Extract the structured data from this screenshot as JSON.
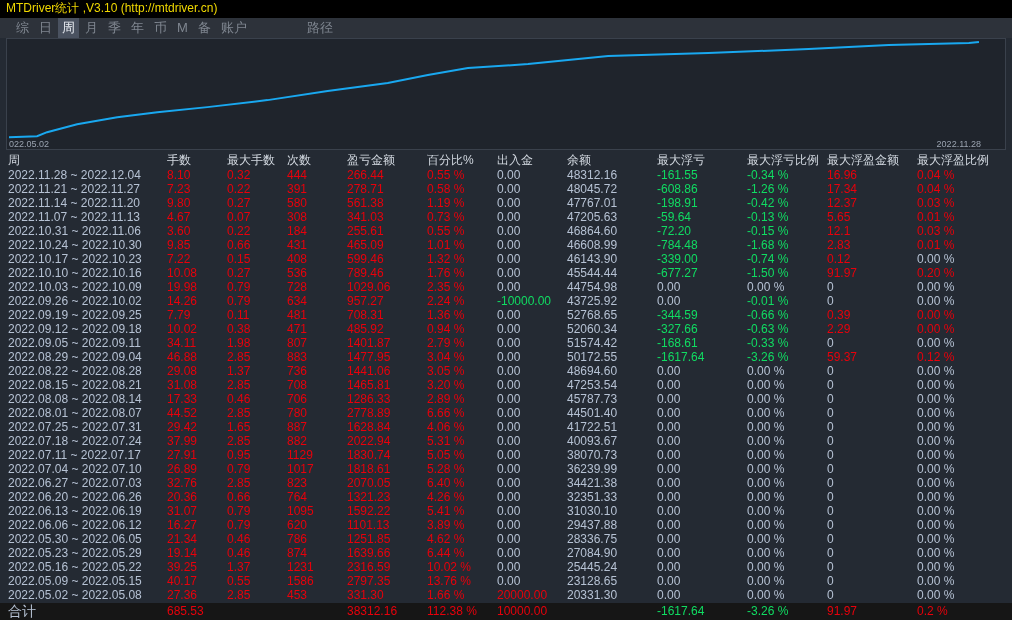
{
  "window": {
    "title": "MTDriver统计 ,V3.10 (http://mtdriver.cn)"
  },
  "tabs": [
    {
      "label": "综",
      "selected": false
    },
    {
      "label": "日",
      "selected": false
    },
    {
      "label": "周",
      "selected": true
    },
    {
      "label": "月",
      "selected": false
    },
    {
      "label": "季",
      "selected": false
    },
    {
      "label": "年",
      "selected": false
    },
    {
      "label": "币",
      "selected": false
    },
    {
      "label": "M",
      "selected": false
    },
    {
      "label": "备",
      "selected": false
    },
    {
      "label": "账户",
      "selected": false
    }
  ],
  "path_tab": {
    "label": "路径",
    "selected": false
  },
  "equity_chart": {
    "start_label": "022.05.02",
    "end_label": "2022.11.28"
  },
  "table": {
    "columns": [
      "周",
      "手数",
      "最大手数",
      "次数",
      "盈亏金额",
      "百分比%",
      "出入金",
      "余额",
      "最大浮亏",
      "最大浮亏比例",
      "最大浮盈金额",
      "最大浮盈比例"
    ],
    "rows": [
      {
        "cells": [
          {
            "text": "2022.11.28 ~ 2022.12.04",
            "color": "#b6c2d4"
          },
          {
            "text": "8.10",
            "color": "#e8000b"
          },
          {
            "text": "0.32",
            "color": "#e8000b"
          },
          {
            "text": "444",
            "color": "#e8000b"
          },
          {
            "text": "266.44",
            "color": "#e8000b"
          },
          {
            "text": "0.55 %",
            "color": "#e8000b"
          },
          {
            "text": "0.00",
            "color": "#b6c2d4"
          },
          {
            "text": "48312.16",
            "color": "#b6c2d4"
          },
          {
            "text": "-161.55",
            "color": "#10dc62"
          },
          {
            "text": "-0.34 %",
            "color": "#10dc62"
          },
          {
            "text": "16.96",
            "color": "#e8000b"
          },
          {
            "text": "0.04 %",
            "color": "#e8000b"
          }
        ]
      },
      {
        "cells": [
          {
            "text": "2022.11.21 ~ 2022.11.27",
            "color": "#b6c2d4"
          },
          {
            "text": "7.23",
            "color": "#e8000b"
          },
          {
            "text": "0.22",
            "color": "#e8000b"
          },
          {
            "text": "391",
            "color": "#e8000b"
          },
          {
            "text": "278.71",
            "color": "#e8000b"
          },
          {
            "text": "0.58 %",
            "color": "#e8000b"
          },
          {
            "text": "0.00",
            "color": "#b6c2d4"
          },
          {
            "text": "48045.72",
            "color": "#b6c2d4"
          },
          {
            "text": "-608.86",
            "color": "#10dc62"
          },
          {
            "text": "-1.26 %",
            "color": "#10dc62"
          },
          {
            "text": "17.34",
            "color": "#e8000b"
          },
          {
            "text": "0.04 %",
            "color": "#e8000b"
          }
        ]
      },
      {
        "cells": [
          {
            "text": "2022.11.14 ~ 2022.11.20",
            "color": "#b6c2d4"
          },
          {
            "text": "9.80",
            "color": "#e8000b"
          },
          {
            "text": "0.27",
            "color": "#e8000b"
          },
          {
            "text": "580",
            "color": "#e8000b"
          },
          {
            "text": "561.38",
            "color": "#e8000b"
          },
          {
            "text": "1.19 %",
            "color": "#e8000b"
          },
          {
            "text": "0.00",
            "color": "#b6c2d4"
          },
          {
            "text": "47767.01",
            "color": "#b6c2d4"
          },
          {
            "text": "-198.91",
            "color": "#10dc62"
          },
          {
            "text": "-0.42 %",
            "color": "#10dc62"
          },
          {
            "text": "12.37",
            "color": "#e8000b"
          },
          {
            "text": "0.03 %",
            "color": "#e8000b"
          }
        ]
      },
      {
        "cells": [
          {
            "text": "2022.11.07 ~ 2022.11.13",
            "color": "#b6c2d4"
          },
          {
            "text": "4.67",
            "color": "#e8000b"
          },
          {
            "text": "0.07",
            "color": "#e8000b"
          },
          {
            "text": "308",
            "color": "#e8000b"
          },
          {
            "text": "341.03",
            "color": "#e8000b"
          },
          {
            "text": "0.73 %",
            "color": "#e8000b"
          },
          {
            "text": "0.00",
            "color": "#b6c2d4"
          },
          {
            "text": "47205.63",
            "color": "#b6c2d4"
          },
          {
            "text": "-59.64",
            "color": "#10dc62"
          },
          {
            "text": "-0.13 %",
            "color": "#10dc62"
          },
          {
            "text": "5.65",
            "color": "#e8000b"
          },
          {
            "text": "0.01 %",
            "color": "#e8000b"
          }
        ]
      },
      {
        "cells": [
          {
            "text": "2022.10.31 ~ 2022.11.06",
            "color": "#b6c2d4"
          },
          {
            "text": "3.60",
            "color": "#e8000b"
          },
          {
            "text": "0.22",
            "color": "#e8000b"
          },
          {
            "text": "184",
            "color": "#e8000b"
          },
          {
            "text": "255.61",
            "color": "#e8000b"
          },
          {
            "text": "0.55 %",
            "color": "#e8000b"
          },
          {
            "text": "0.00",
            "color": "#b6c2d4"
          },
          {
            "text": "46864.60",
            "color": "#b6c2d4"
          },
          {
            "text": "-72.20",
            "color": "#10dc62"
          },
          {
            "text": "-0.15 %",
            "color": "#10dc62"
          },
          {
            "text": "12.1",
            "color": "#e8000b"
          },
          {
            "text": "0.03 %",
            "color": "#e8000b"
          }
        ]
      },
      {
        "cells": [
          {
            "text": "2022.10.24 ~ 2022.10.30",
            "color": "#b6c2d4"
          },
          {
            "text": "9.85",
            "color": "#e8000b"
          },
          {
            "text": "0.66",
            "color": "#e8000b"
          },
          {
            "text": "431",
            "color": "#e8000b"
          },
          {
            "text": "465.09",
            "color": "#e8000b"
          },
          {
            "text": "1.01 %",
            "color": "#e8000b"
          },
          {
            "text": "0.00",
            "color": "#b6c2d4"
          },
          {
            "text": "46608.99",
            "color": "#b6c2d4"
          },
          {
            "text": "-784.48",
            "color": "#10dc62"
          },
          {
            "text": "-1.68 %",
            "color": "#10dc62"
          },
          {
            "text": "2.83",
            "color": "#e8000b"
          },
          {
            "text": "0.01 %",
            "color": "#e8000b"
          }
        ]
      },
      {
        "cells": [
          {
            "text": "2022.10.17 ~ 2022.10.23",
            "color": "#b6c2d4"
          },
          {
            "text": "7.22",
            "color": "#e8000b"
          },
          {
            "text": "0.15",
            "color": "#e8000b"
          },
          {
            "text": "408",
            "color": "#e8000b"
          },
          {
            "text": "599.46",
            "color": "#e8000b"
          },
          {
            "text": "1.32 %",
            "color": "#e8000b"
          },
          {
            "text": "0.00",
            "color": "#b6c2d4"
          },
          {
            "text": "46143.90",
            "color": "#b6c2d4"
          },
          {
            "text": "-339.00",
            "color": "#10dc62"
          },
          {
            "text": "-0.74 %",
            "color": "#10dc62"
          },
          {
            "text": "0.12",
            "color": "#e8000b"
          },
          {
            "text": "0.00 %",
            "color": "#b6c2d4"
          }
        ]
      },
      {
        "cells": [
          {
            "text": "2022.10.10 ~ 2022.10.16",
            "color": "#b6c2d4"
          },
          {
            "text": "10.08",
            "color": "#e8000b"
          },
          {
            "text": "0.27",
            "color": "#e8000b"
          },
          {
            "text": "536",
            "color": "#e8000b"
          },
          {
            "text": "789.46",
            "color": "#e8000b"
          },
          {
            "text": "1.76 %",
            "color": "#e8000b"
          },
          {
            "text": "0.00",
            "color": "#b6c2d4"
          },
          {
            "text": "45544.44",
            "color": "#b6c2d4"
          },
          {
            "text": "-677.27",
            "color": "#10dc62"
          },
          {
            "text": "-1.50 %",
            "color": "#10dc62"
          },
          {
            "text": "91.97",
            "color": "#e8000b"
          },
          {
            "text": "0.20 %",
            "color": "#e8000b"
          }
        ]
      },
      {
        "cells": [
          {
            "text": "2022.10.03 ~ 2022.10.09",
            "color": "#b6c2d4"
          },
          {
            "text": "19.98",
            "color": "#e8000b"
          },
          {
            "text": "0.79",
            "color": "#e8000b"
          },
          {
            "text": "728",
            "color": "#e8000b"
          },
          {
            "text": "1029.06",
            "color": "#e8000b"
          },
          {
            "text": "2.35 %",
            "color": "#e8000b"
          },
          {
            "text": "0.00",
            "color": "#b6c2d4"
          },
          {
            "text": "44754.98",
            "color": "#b6c2d4"
          },
          {
            "text": "0.00",
            "color": "#b6c2d4"
          },
          {
            "text": "0.00 %",
            "color": "#b6c2d4"
          },
          {
            "text": "0",
            "color": "#b6c2d4"
          },
          {
            "text": "0.00 %",
            "color": "#b6c2d4"
          }
        ]
      },
      {
        "cells": [
          {
            "text": "2022.09.26 ~ 2022.10.02",
            "color": "#b6c2d4"
          },
          {
            "text": "14.26",
            "color": "#e8000b"
          },
          {
            "text": "0.79",
            "color": "#e8000b"
          },
          {
            "text": "634",
            "color": "#e8000b"
          },
          {
            "text": "957.27",
            "color": "#e8000b"
          },
          {
            "text": "2.24 %",
            "color": "#e8000b"
          },
          {
            "text": "-10000.00",
            "color": "#10dc62"
          },
          {
            "text": "43725.92",
            "color": "#b6c2d4"
          },
          {
            "text": "0.00",
            "color": "#b6c2d4"
          },
          {
            "text": "-0.01 %",
            "color": "#10dc62"
          },
          {
            "text": "0",
            "color": "#b6c2d4"
          },
          {
            "text": "0.00 %",
            "color": "#b6c2d4"
          }
        ]
      },
      {
        "cells": [
          {
            "text": "2022.09.19 ~ 2022.09.25",
            "color": "#b6c2d4"
          },
          {
            "text": "7.79",
            "color": "#e8000b"
          },
          {
            "text": "0.11",
            "color": "#e8000b"
          },
          {
            "text": "481",
            "color": "#e8000b"
          },
          {
            "text": "708.31",
            "color": "#e8000b"
          },
          {
            "text": "1.36 %",
            "color": "#e8000b"
          },
          {
            "text": "0.00",
            "color": "#b6c2d4"
          },
          {
            "text": "52768.65",
            "color": "#b6c2d4"
          },
          {
            "text": "-344.59",
            "color": "#10dc62"
          },
          {
            "text": "-0.66 %",
            "color": "#10dc62"
          },
          {
            "text": "0.39",
            "color": "#e8000b"
          },
          {
            "text": "0.00 %",
            "color": "#e8000b"
          }
        ]
      },
      {
        "cells": [
          {
            "text": "2022.09.12 ~ 2022.09.18",
            "color": "#b6c2d4"
          },
          {
            "text": "10.02",
            "color": "#e8000b"
          },
          {
            "text": "0.38",
            "color": "#e8000b"
          },
          {
            "text": "471",
            "color": "#e8000b"
          },
          {
            "text": "485.92",
            "color": "#e8000b"
          },
          {
            "text": "0.94 %",
            "color": "#e8000b"
          },
          {
            "text": "0.00",
            "color": "#b6c2d4"
          },
          {
            "text": "52060.34",
            "color": "#b6c2d4"
          },
          {
            "text": "-327.66",
            "color": "#10dc62"
          },
          {
            "text": "-0.63 %",
            "color": "#10dc62"
          },
          {
            "text": "2.29",
            "color": "#e8000b"
          },
          {
            "text": "0.00 %",
            "color": "#e8000b"
          }
        ]
      },
      {
        "cells": [
          {
            "text": "2022.09.05 ~ 2022.09.11",
            "color": "#b6c2d4"
          },
          {
            "text": "34.11",
            "color": "#e8000b"
          },
          {
            "text": "1.98",
            "color": "#e8000b"
          },
          {
            "text": "807",
            "color": "#e8000b"
          },
          {
            "text": "1401.87",
            "color": "#e8000b"
          },
          {
            "text": "2.79 %",
            "color": "#e8000b"
          },
          {
            "text": "0.00",
            "color": "#b6c2d4"
          },
          {
            "text": "51574.42",
            "color": "#b6c2d4"
          },
          {
            "text": "-168.61",
            "color": "#10dc62"
          },
          {
            "text": "-0.33 %",
            "color": "#10dc62"
          },
          {
            "text": "0",
            "color": "#b6c2d4"
          },
          {
            "text": "0.00 %",
            "color": "#b6c2d4"
          }
        ]
      },
      {
        "cells": [
          {
            "text": "2022.08.29 ~ 2022.09.04",
            "color": "#b6c2d4"
          },
          {
            "text": "46.88",
            "color": "#e8000b"
          },
          {
            "text": "2.85",
            "color": "#e8000b"
          },
          {
            "text": "883",
            "color": "#e8000b"
          },
          {
            "text": "1477.95",
            "color": "#e8000b"
          },
          {
            "text": "3.04 %",
            "color": "#e8000b"
          },
          {
            "text": "0.00",
            "color": "#b6c2d4"
          },
          {
            "text": "50172.55",
            "color": "#b6c2d4"
          },
          {
            "text": "-1617.64",
            "color": "#10dc62"
          },
          {
            "text": "-3.26 %",
            "color": "#10dc62"
          },
          {
            "text": "59.37",
            "color": "#e8000b"
          },
          {
            "text": "0.12 %",
            "color": "#e8000b"
          }
        ]
      },
      {
        "cells": [
          {
            "text": "2022.08.22 ~ 2022.08.28",
            "color": "#b6c2d4"
          },
          {
            "text": "29.08",
            "color": "#e8000b"
          },
          {
            "text": "1.37",
            "color": "#e8000b"
          },
          {
            "text": "736",
            "color": "#e8000b"
          },
          {
            "text": "1441.06",
            "color": "#e8000b"
          },
          {
            "text": "3.05 %",
            "color": "#e8000b"
          },
          {
            "text": "0.00",
            "color": "#b6c2d4"
          },
          {
            "text": "48694.60",
            "color": "#b6c2d4"
          },
          {
            "text": "0.00",
            "color": "#b6c2d4"
          },
          {
            "text": "0.00 %",
            "color": "#b6c2d4"
          },
          {
            "text": "0",
            "color": "#b6c2d4"
          },
          {
            "text": "0.00 %",
            "color": "#b6c2d4"
          }
        ]
      },
      {
        "cells": [
          {
            "text": "2022.08.15 ~ 2022.08.21",
            "color": "#b6c2d4"
          },
          {
            "text": "31.08",
            "color": "#e8000b"
          },
          {
            "text": "2.85",
            "color": "#e8000b"
          },
          {
            "text": "708",
            "color": "#e8000b"
          },
          {
            "text": "1465.81",
            "color": "#e8000b"
          },
          {
            "text": "3.20 %",
            "color": "#e8000b"
          },
          {
            "text": "0.00",
            "color": "#b6c2d4"
          },
          {
            "text": "47253.54",
            "color": "#b6c2d4"
          },
          {
            "text": "0.00",
            "color": "#b6c2d4"
          },
          {
            "text": "0.00 %",
            "color": "#b6c2d4"
          },
          {
            "text": "0",
            "color": "#b6c2d4"
          },
          {
            "text": "0.00 %",
            "color": "#b6c2d4"
          }
        ]
      },
      {
        "cells": [
          {
            "text": "2022.08.08 ~ 2022.08.14",
            "color": "#b6c2d4"
          },
          {
            "text": "17.33",
            "color": "#e8000b"
          },
          {
            "text": "0.46",
            "color": "#e8000b"
          },
          {
            "text": "706",
            "color": "#e8000b"
          },
          {
            "text": "1286.33",
            "color": "#e8000b"
          },
          {
            "text": "2.89 %",
            "color": "#e8000b"
          },
          {
            "text": "0.00",
            "color": "#b6c2d4"
          },
          {
            "text": "45787.73",
            "color": "#b6c2d4"
          },
          {
            "text": "0.00",
            "color": "#b6c2d4"
          },
          {
            "text": "0.00 %",
            "color": "#b6c2d4"
          },
          {
            "text": "0",
            "color": "#b6c2d4"
          },
          {
            "text": "0.00 %",
            "color": "#b6c2d4"
          }
        ]
      },
      {
        "cells": [
          {
            "text": "2022.08.01 ~ 2022.08.07",
            "color": "#b6c2d4"
          },
          {
            "text": "44.52",
            "color": "#e8000b"
          },
          {
            "text": "2.85",
            "color": "#e8000b"
          },
          {
            "text": "780",
            "color": "#e8000b"
          },
          {
            "text": "2778.89",
            "color": "#e8000b"
          },
          {
            "text": "6.66 %",
            "color": "#e8000b"
          },
          {
            "text": "0.00",
            "color": "#b6c2d4"
          },
          {
            "text": "44501.40",
            "color": "#b6c2d4"
          },
          {
            "text": "0.00",
            "color": "#b6c2d4"
          },
          {
            "text": "0.00 %",
            "color": "#b6c2d4"
          },
          {
            "text": "0",
            "color": "#b6c2d4"
          },
          {
            "text": "0.00 %",
            "color": "#b6c2d4"
          }
        ]
      },
      {
        "cells": [
          {
            "text": "2022.07.25 ~ 2022.07.31",
            "color": "#b6c2d4"
          },
          {
            "text": "29.42",
            "color": "#e8000b"
          },
          {
            "text": "1.65",
            "color": "#e8000b"
          },
          {
            "text": "887",
            "color": "#e8000b"
          },
          {
            "text": "1628.84",
            "color": "#e8000b"
          },
          {
            "text": "4.06 %",
            "color": "#e8000b"
          },
          {
            "text": "0.00",
            "color": "#b6c2d4"
          },
          {
            "text": "41722.51",
            "color": "#b6c2d4"
          },
          {
            "text": "0.00",
            "color": "#b6c2d4"
          },
          {
            "text": "0.00 %",
            "color": "#b6c2d4"
          },
          {
            "text": "0",
            "color": "#b6c2d4"
          },
          {
            "text": "0.00 %",
            "color": "#b6c2d4"
          }
        ]
      },
      {
        "cells": [
          {
            "text": "2022.07.18 ~ 2022.07.24",
            "color": "#b6c2d4"
          },
          {
            "text": "37.99",
            "color": "#e8000b"
          },
          {
            "text": "2.85",
            "color": "#e8000b"
          },
          {
            "text": "882",
            "color": "#e8000b"
          },
          {
            "text": "2022.94",
            "color": "#e8000b"
          },
          {
            "text": "5.31 %",
            "color": "#e8000b"
          },
          {
            "text": "0.00",
            "color": "#b6c2d4"
          },
          {
            "text": "40093.67",
            "color": "#b6c2d4"
          },
          {
            "text": "0.00",
            "color": "#b6c2d4"
          },
          {
            "text": "0.00 %",
            "color": "#b6c2d4"
          },
          {
            "text": "0",
            "color": "#b6c2d4"
          },
          {
            "text": "0.00 %",
            "color": "#b6c2d4"
          }
        ]
      },
      {
        "cells": [
          {
            "text": "2022.07.11 ~ 2022.07.17",
            "color": "#b6c2d4"
          },
          {
            "text": "27.91",
            "color": "#e8000b"
          },
          {
            "text": "0.95",
            "color": "#e8000b"
          },
          {
            "text": "1129",
            "color": "#e8000b"
          },
          {
            "text": "1830.74",
            "color": "#e8000b"
          },
          {
            "text": "5.05 %",
            "color": "#e8000b"
          },
          {
            "text": "0.00",
            "color": "#b6c2d4"
          },
          {
            "text": "38070.73",
            "color": "#b6c2d4"
          },
          {
            "text": "0.00",
            "color": "#b6c2d4"
          },
          {
            "text": "0.00 %",
            "color": "#b6c2d4"
          },
          {
            "text": "0",
            "color": "#b6c2d4"
          },
          {
            "text": "0.00 %",
            "color": "#b6c2d4"
          }
        ]
      },
      {
        "cells": [
          {
            "text": "2022.07.04 ~ 2022.07.10",
            "color": "#b6c2d4"
          },
          {
            "text": "26.89",
            "color": "#e8000b"
          },
          {
            "text": "0.79",
            "color": "#e8000b"
          },
          {
            "text": "1017",
            "color": "#e8000b"
          },
          {
            "text": "1818.61",
            "color": "#e8000b"
          },
          {
            "text": "5.28 %",
            "color": "#e8000b"
          },
          {
            "text": "0.00",
            "color": "#b6c2d4"
          },
          {
            "text": "36239.99",
            "color": "#b6c2d4"
          },
          {
            "text": "0.00",
            "color": "#b6c2d4"
          },
          {
            "text": "0.00 %",
            "color": "#b6c2d4"
          },
          {
            "text": "0",
            "color": "#b6c2d4"
          },
          {
            "text": "0.00 %",
            "color": "#b6c2d4"
          }
        ]
      },
      {
        "cells": [
          {
            "text": "2022.06.27 ~ 2022.07.03",
            "color": "#b6c2d4"
          },
          {
            "text": "32.76",
            "color": "#e8000b"
          },
          {
            "text": "2.85",
            "color": "#e8000b"
          },
          {
            "text": "823",
            "color": "#e8000b"
          },
          {
            "text": "2070.05",
            "color": "#e8000b"
          },
          {
            "text": "6.40 %",
            "color": "#e8000b"
          },
          {
            "text": "0.00",
            "color": "#b6c2d4"
          },
          {
            "text": "34421.38",
            "color": "#b6c2d4"
          },
          {
            "text": "0.00",
            "color": "#b6c2d4"
          },
          {
            "text": "0.00 %",
            "color": "#b6c2d4"
          },
          {
            "text": "0",
            "color": "#b6c2d4"
          },
          {
            "text": "0.00 %",
            "color": "#b6c2d4"
          }
        ]
      },
      {
        "cells": [
          {
            "text": "2022.06.20 ~ 2022.06.26",
            "color": "#b6c2d4"
          },
          {
            "text": "20.36",
            "color": "#e8000b"
          },
          {
            "text": "0.66",
            "color": "#e8000b"
          },
          {
            "text": "764",
            "color": "#e8000b"
          },
          {
            "text": "1321.23",
            "color": "#e8000b"
          },
          {
            "text": "4.26 %",
            "color": "#e8000b"
          },
          {
            "text": "0.00",
            "color": "#b6c2d4"
          },
          {
            "text": "32351.33",
            "color": "#b6c2d4"
          },
          {
            "text": "0.00",
            "color": "#b6c2d4"
          },
          {
            "text": "0.00 %",
            "color": "#b6c2d4"
          },
          {
            "text": "0",
            "color": "#b6c2d4"
          },
          {
            "text": "0.00 %",
            "color": "#b6c2d4"
          }
        ]
      },
      {
        "cells": [
          {
            "text": "2022.06.13 ~ 2022.06.19",
            "color": "#b6c2d4"
          },
          {
            "text": "31.07",
            "color": "#e8000b"
          },
          {
            "text": "0.79",
            "color": "#e8000b"
          },
          {
            "text": "1095",
            "color": "#e8000b"
          },
          {
            "text": "1592.22",
            "color": "#e8000b"
          },
          {
            "text": "5.41 %",
            "color": "#e8000b"
          },
          {
            "text": "0.00",
            "color": "#b6c2d4"
          },
          {
            "text": "31030.10",
            "color": "#b6c2d4"
          },
          {
            "text": "0.00",
            "color": "#b6c2d4"
          },
          {
            "text": "0.00 %",
            "color": "#b6c2d4"
          },
          {
            "text": "0",
            "color": "#b6c2d4"
          },
          {
            "text": "0.00 %",
            "color": "#b6c2d4"
          }
        ]
      },
      {
        "cells": [
          {
            "text": "2022.06.06 ~ 2022.06.12",
            "color": "#b6c2d4"
          },
          {
            "text": "16.27",
            "color": "#e8000b"
          },
          {
            "text": "0.79",
            "color": "#e8000b"
          },
          {
            "text": "620",
            "color": "#e8000b"
          },
          {
            "text": "1101.13",
            "color": "#e8000b"
          },
          {
            "text": "3.89 %",
            "color": "#e8000b"
          },
          {
            "text": "0.00",
            "color": "#b6c2d4"
          },
          {
            "text": "29437.88",
            "color": "#b6c2d4"
          },
          {
            "text": "0.00",
            "color": "#b6c2d4"
          },
          {
            "text": "0.00 %",
            "color": "#b6c2d4"
          },
          {
            "text": "0",
            "color": "#b6c2d4"
          },
          {
            "text": "0.00 %",
            "color": "#b6c2d4"
          }
        ]
      },
      {
        "cells": [
          {
            "text": "2022.05.30 ~ 2022.06.05",
            "color": "#b6c2d4"
          },
          {
            "text": "21.34",
            "color": "#e8000b"
          },
          {
            "text": "0.46",
            "color": "#e8000b"
          },
          {
            "text": "786",
            "color": "#e8000b"
          },
          {
            "text": "1251.85",
            "color": "#e8000b"
          },
          {
            "text": "4.62 %",
            "color": "#e8000b"
          },
          {
            "text": "0.00",
            "color": "#b6c2d4"
          },
          {
            "text": "28336.75",
            "color": "#b6c2d4"
          },
          {
            "text": "0.00",
            "color": "#b6c2d4"
          },
          {
            "text": "0.00 %",
            "color": "#b6c2d4"
          },
          {
            "text": "0",
            "color": "#b6c2d4"
          },
          {
            "text": "0.00 %",
            "color": "#b6c2d4"
          }
        ]
      },
      {
        "cells": [
          {
            "text": "2022.05.23 ~ 2022.05.29",
            "color": "#b6c2d4"
          },
          {
            "text": "19.14",
            "color": "#e8000b"
          },
          {
            "text": "0.46",
            "color": "#e8000b"
          },
          {
            "text": "874",
            "color": "#e8000b"
          },
          {
            "text": "1639.66",
            "color": "#e8000b"
          },
          {
            "text": "6.44 %",
            "color": "#e8000b"
          },
          {
            "text": "0.00",
            "color": "#b6c2d4"
          },
          {
            "text": "27084.90",
            "color": "#b6c2d4"
          },
          {
            "text": "0.00",
            "color": "#b6c2d4"
          },
          {
            "text": "0.00 %",
            "color": "#b6c2d4"
          },
          {
            "text": "0",
            "color": "#b6c2d4"
          },
          {
            "text": "0.00 %",
            "color": "#b6c2d4"
          }
        ]
      },
      {
        "cells": [
          {
            "text": "2022.05.16 ~ 2022.05.22",
            "color": "#b6c2d4"
          },
          {
            "text": "39.25",
            "color": "#e8000b"
          },
          {
            "text": "1.37",
            "color": "#e8000b"
          },
          {
            "text": "1231",
            "color": "#e8000b"
          },
          {
            "text": "2316.59",
            "color": "#e8000b"
          },
          {
            "text": "10.02 %",
            "color": "#e8000b"
          },
          {
            "text": "0.00",
            "color": "#b6c2d4"
          },
          {
            "text": "25445.24",
            "color": "#b6c2d4"
          },
          {
            "text": "0.00",
            "color": "#b6c2d4"
          },
          {
            "text": "0.00 %",
            "color": "#b6c2d4"
          },
          {
            "text": "0",
            "color": "#b6c2d4"
          },
          {
            "text": "0.00 %",
            "color": "#b6c2d4"
          }
        ]
      },
      {
        "cells": [
          {
            "text": "2022.05.09 ~ 2022.05.15",
            "color": "#b6c2d4"
          },
          {
            "text": "40.17",
            "color": "#e8000b"
          },
          {
            "text": "0.55",
            "color": "#e8000b"
          },
          {
            "text": "1586",
            "color": "#e8000b"
          },
          {
            "text": "2797.35",
            "color": "#e8000b"
          },
          {
            "text": "13.76 %",
            "color": "#e8000b"
          },
          {
            "text": "0.00",
            "color": "#b6c2d4"
          },
          {
            "text": "23128.65",
            "color": "#b6c2d4"
          },
          {
            "text": "0.00",
            "color": "#b6c2d4"
          },
          {
            "text": "0.00 %",
            "color": "#b6c2d4"
          },
          {
            "text": "0",
            "color": "#b6c2d4"
          },
          {
            "text": "0.00 %",
            "color": "#b6c2d4"
          }
        ]
      },
      {
        "cells": [
          {
            "text": "2022.05.02 ~ 2022.05.08",
            "color": "#b6c2d4"
          },
          {
            "text": "27.36",
            "color": "#e8000b"
          },
          {
            "text": "2.85",
            "color": "#e8000b"
          },
          {
            "text": "453",
            "color": "#e8000b"
          },
          {
            "text": "331.30",
            "color": "#e8000b"
          },
          {
            "text": "1.66 %",
            "color": "#e8000b"
          },
          {
            "text": "20000.00",
            "color": "#e8000b"
          },
          {
            "text": "20331.30",
            "color": "#b6c2d4"
          },
          {
            "text": "0.00",
            "color": "#b6c2d4"
          },
          {
            "text": "0.00 %",
            "color": "#b6c2d4"
          },
          {
            "text": "0",
            "color": "#b6c2d4"
          },
          {
            "text": "0.00 %",
            "color": "#b6c2d4"
          }
        ]
      }
    ],
    "total": {
      "cells": [
        {
          "text": "合计",
          "color": "#b6c2d4"
        },
        {
          "text": "685.53",
          "color": "#e8000b"
        },
        null,
        null,
        {
          "text": "38312.16",
          "color": "#e8000b"
        },
        {
          "text": "112.38 %",
          "color": "#e8000b"
        },
        {
          "text": "10000.00",
          "color": "#e8000b"
        },
        null,
        {
          "text": "-1617.64",
          "color": "#10dc62"
        },
        {
          "text": "-3.26 %",
          "color": "#10dc62"
        },
        {
          "text": "91.97",
          "color": "#e8000b"
        },
        {
          "text": "0.2 %",
          "color": "#e8000b"
        }
      ]
    }
  }
}
